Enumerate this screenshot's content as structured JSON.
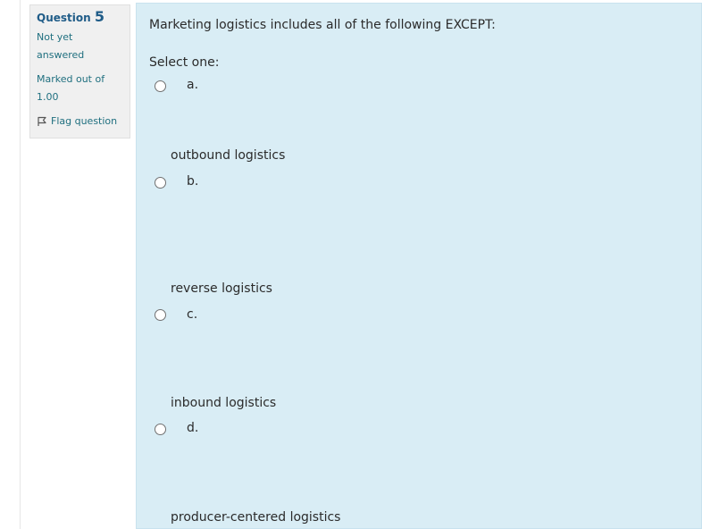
{
  "question": {
    "label": "Question",
    "number": "5",
    "state": [
      "Not yet",
      "answered"
    ],
    "grade": [
      "Marked out of",
      "1.00"
    ],
    "flag_label": "Flag question",
    "text": "Marketing logistics includes all of the following EXCEPT:",
    "prompt": "Select one:"
  },
  "options": [
    {
      "letter": "a.",
      "text": "outbound logistics"
    },
    {
      "letter": "b.",
      "text": "reverse logistics"
    },
    {
      "letter": "c.",
      "text": "inbound logistics"
    },
    {
      "letter": "d.",
      "text": "producer-centered logistics"
    }
  ],
  "icons": {
    "flag": "flag-icon"
  }
}
